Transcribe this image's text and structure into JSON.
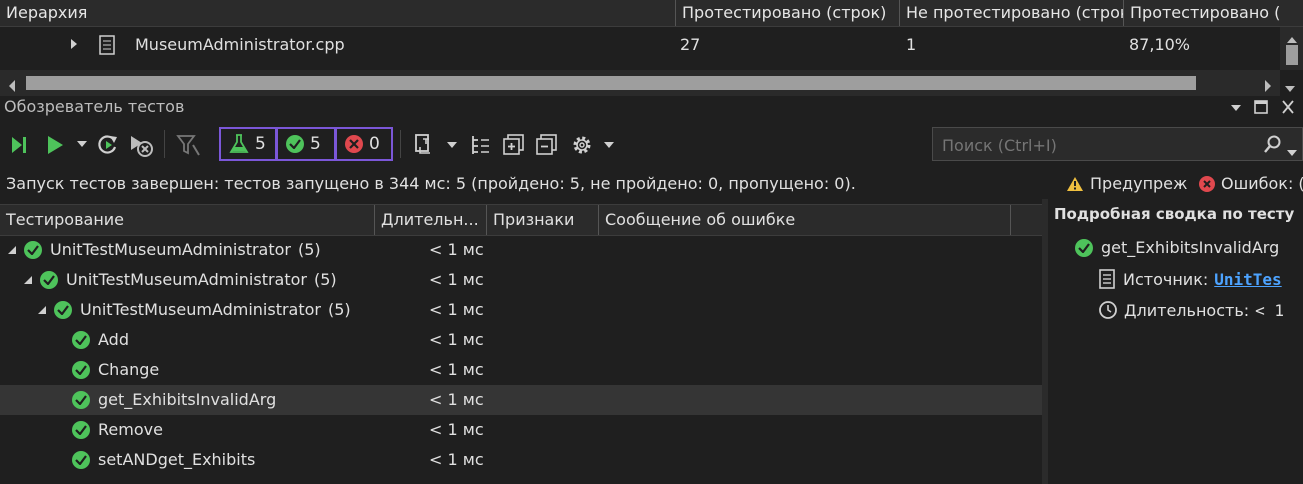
{
  "coverage": {
    "columns": [
      "Иерархия",
      "Протестировано (строк)",
      "Не протестировано (строк",
      "Протестировано ("
    ],
    "row": {
      "name": "MuseumAdministrator.cpp",
      "covered": "27",
      "not_covered": "1",
      "percent": "87,10%"
    }
  },
  "test_explorer": {
    "title": "Обозреватель тестов",
    "counters": {
      "total": "5",
      "passed": "5",
      "failed": "0"
    },
    "search_placeholder": "Поиск (Ctrl+I)",
    "status": "Запуск тестов завершен: тестов запущено в 344 мс: 5 (пройдено: 5, не пройдено: 0, пропущено: 0).",
    "warnings_label": "Предупреж",
    "errors_label": "Ошибок: (",
    "grid_columns": [
      "Тестирование",
      "Длительн...",
      "Признаки",
      "Сообщение об ошибке"
    ],
    "rows": [
      {
        "name": "UnitTestMuseumAdministrator",
        "count": "(5)",
        "duration": "< 1 мс"
      },
      {
        "name": "UnitTestMuseumAdministrator",
        "count": "(5)",
        "duration": "< 1 мс"
      },
      {
        "name": "UnitTestMuseumAdministrator",
        "count": "(5)",
        "duration": "< 1 мс"
      },
      {
        "name": "Add",
        "count": "",
        "duration": "< 1 мс"
      },
      {
        "name": "Change",
        "count": "",
        "duration": "< 1 мс"
      },
      {
        "name": "get_ExhibitsInvalidArg",
        "count": "",
        "duration": "< 1 мс"
      },
      {
        "name": "Remove",
        "count": "",
        "duration": "< 1 мс"
      },
      {
        "name": "setANDget_Exhibits",
        "count": "",
        "duration": "< 1 мс"
      }
    ],
    "detail": {
      "title": "Подробная сводка по тесту",
      "test_name": "get_ExhibitsInvalidArg",
      "source_label": "Источник:",
      "source_value": "UnitTes",
      "duration_label": "Длительность:",
      "duration_value": "< 1"
    }
  },
  "colors": {
    "accent": "#7b57d8",
    "pass": "#4ec35b",
    "fail": "#e0484e",
    "link": "#4da3ff"
  }
}
